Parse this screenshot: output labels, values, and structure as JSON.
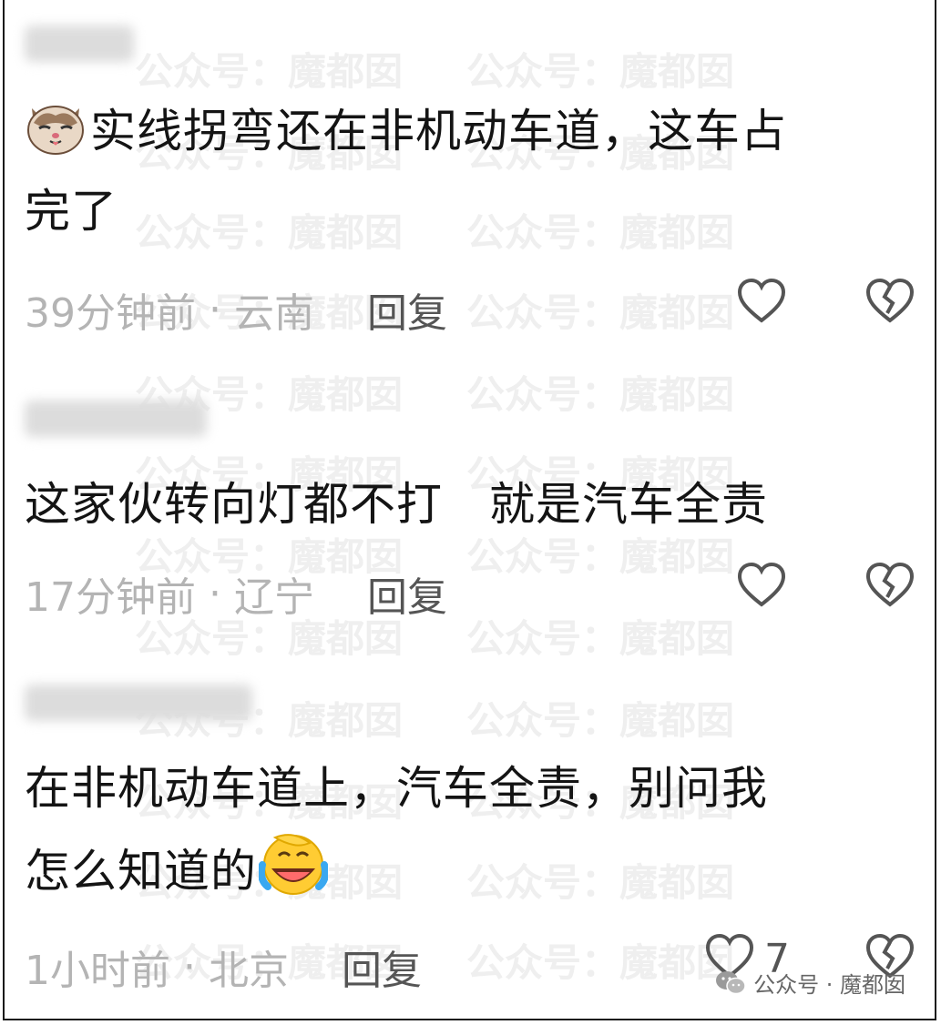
{
  "watermark": {
    "text": "公众号：魔都囡"
  },
  "comments": [
    {
      "text_line1": "实线拐弯还在非机动车道，这车占",
      "text_line2": "完了",
      "emoji": "cat-face-emoji",
      "time": "39分钟前",
      "separator": "·",
      "location": "云南",
      "reply_label": "回复"
    },
    {
      "text_line1": "这家伙转向灯都不打　就是汽车全责",
      "time": "17分钟前",
      "separator": "·",
      "location": "辽宁",
      "reply_label": "回复"
    },
    {
      "text_line1": "在非机动车道上，汽车全责，别问我",
      "text_line2": "怎么知道的",
      "emoji": "laughing-crying-emoji",
      "time": "1小时前",
      "separator": "·",
      "location": "北京",
      "reply_label": "回复",
      "like_count": "7"
    }
  ],
  "footer": {
    "label": "公众号 · 魔都囡"
  },
  "icons": {
    "like": "heart-outline-icon",
    "dislike": "broken-heart-icon"
  },
  "colors": {
    "text": "#141414",
    "meta": "#b4b4b4",
    "reply": "#555555",
    "watermark": "#efefef"
  }
}
